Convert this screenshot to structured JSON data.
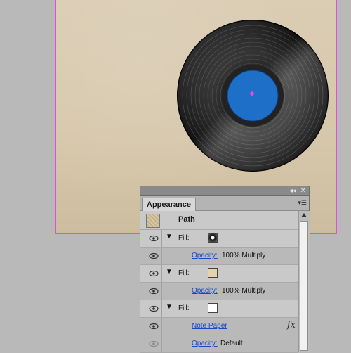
{
  "artboard": {
    "record_colors": {
      "vinyl": "#1b1b1b",
      "label": "#1e6fc8",
      "center_point": "#e64be0"
    }
  },
  "panel": {
    "window_controls": {
      "collapse": "◂◂",
      "close": "✕"
    },
    "tab_label": "Appearance",
    "menu_icon": "panel-menu-icon",
    "path_label": "Path",
    "rows": [
      {
        "type": "fill",
        "label": "Fill:",
        "swatch": "record-thumb"
      },
      {
        "type": "opacity",
        "link": "Opacity:",
        "value": "100% Multiply"
      },
      {
        "type": "fill",
        "label": "Fill:",
        "swatch": "#e6d2ad"
      },
      {
        "type": "opacity",
        "link": "Opacity:",
        "value": "100% Multiply"
      },
      {
        "type": "fill",
        "label": "Fill:",
        "swatch": "#ffffff"
      },
      {
        "type": "effect",
        "link": "Note Paper",
        "fx": "fx"
      },
      {
        "type": "opacity",
        "link": "Opacity:",
        "value": "Default"
      }
    ]
  }
}
